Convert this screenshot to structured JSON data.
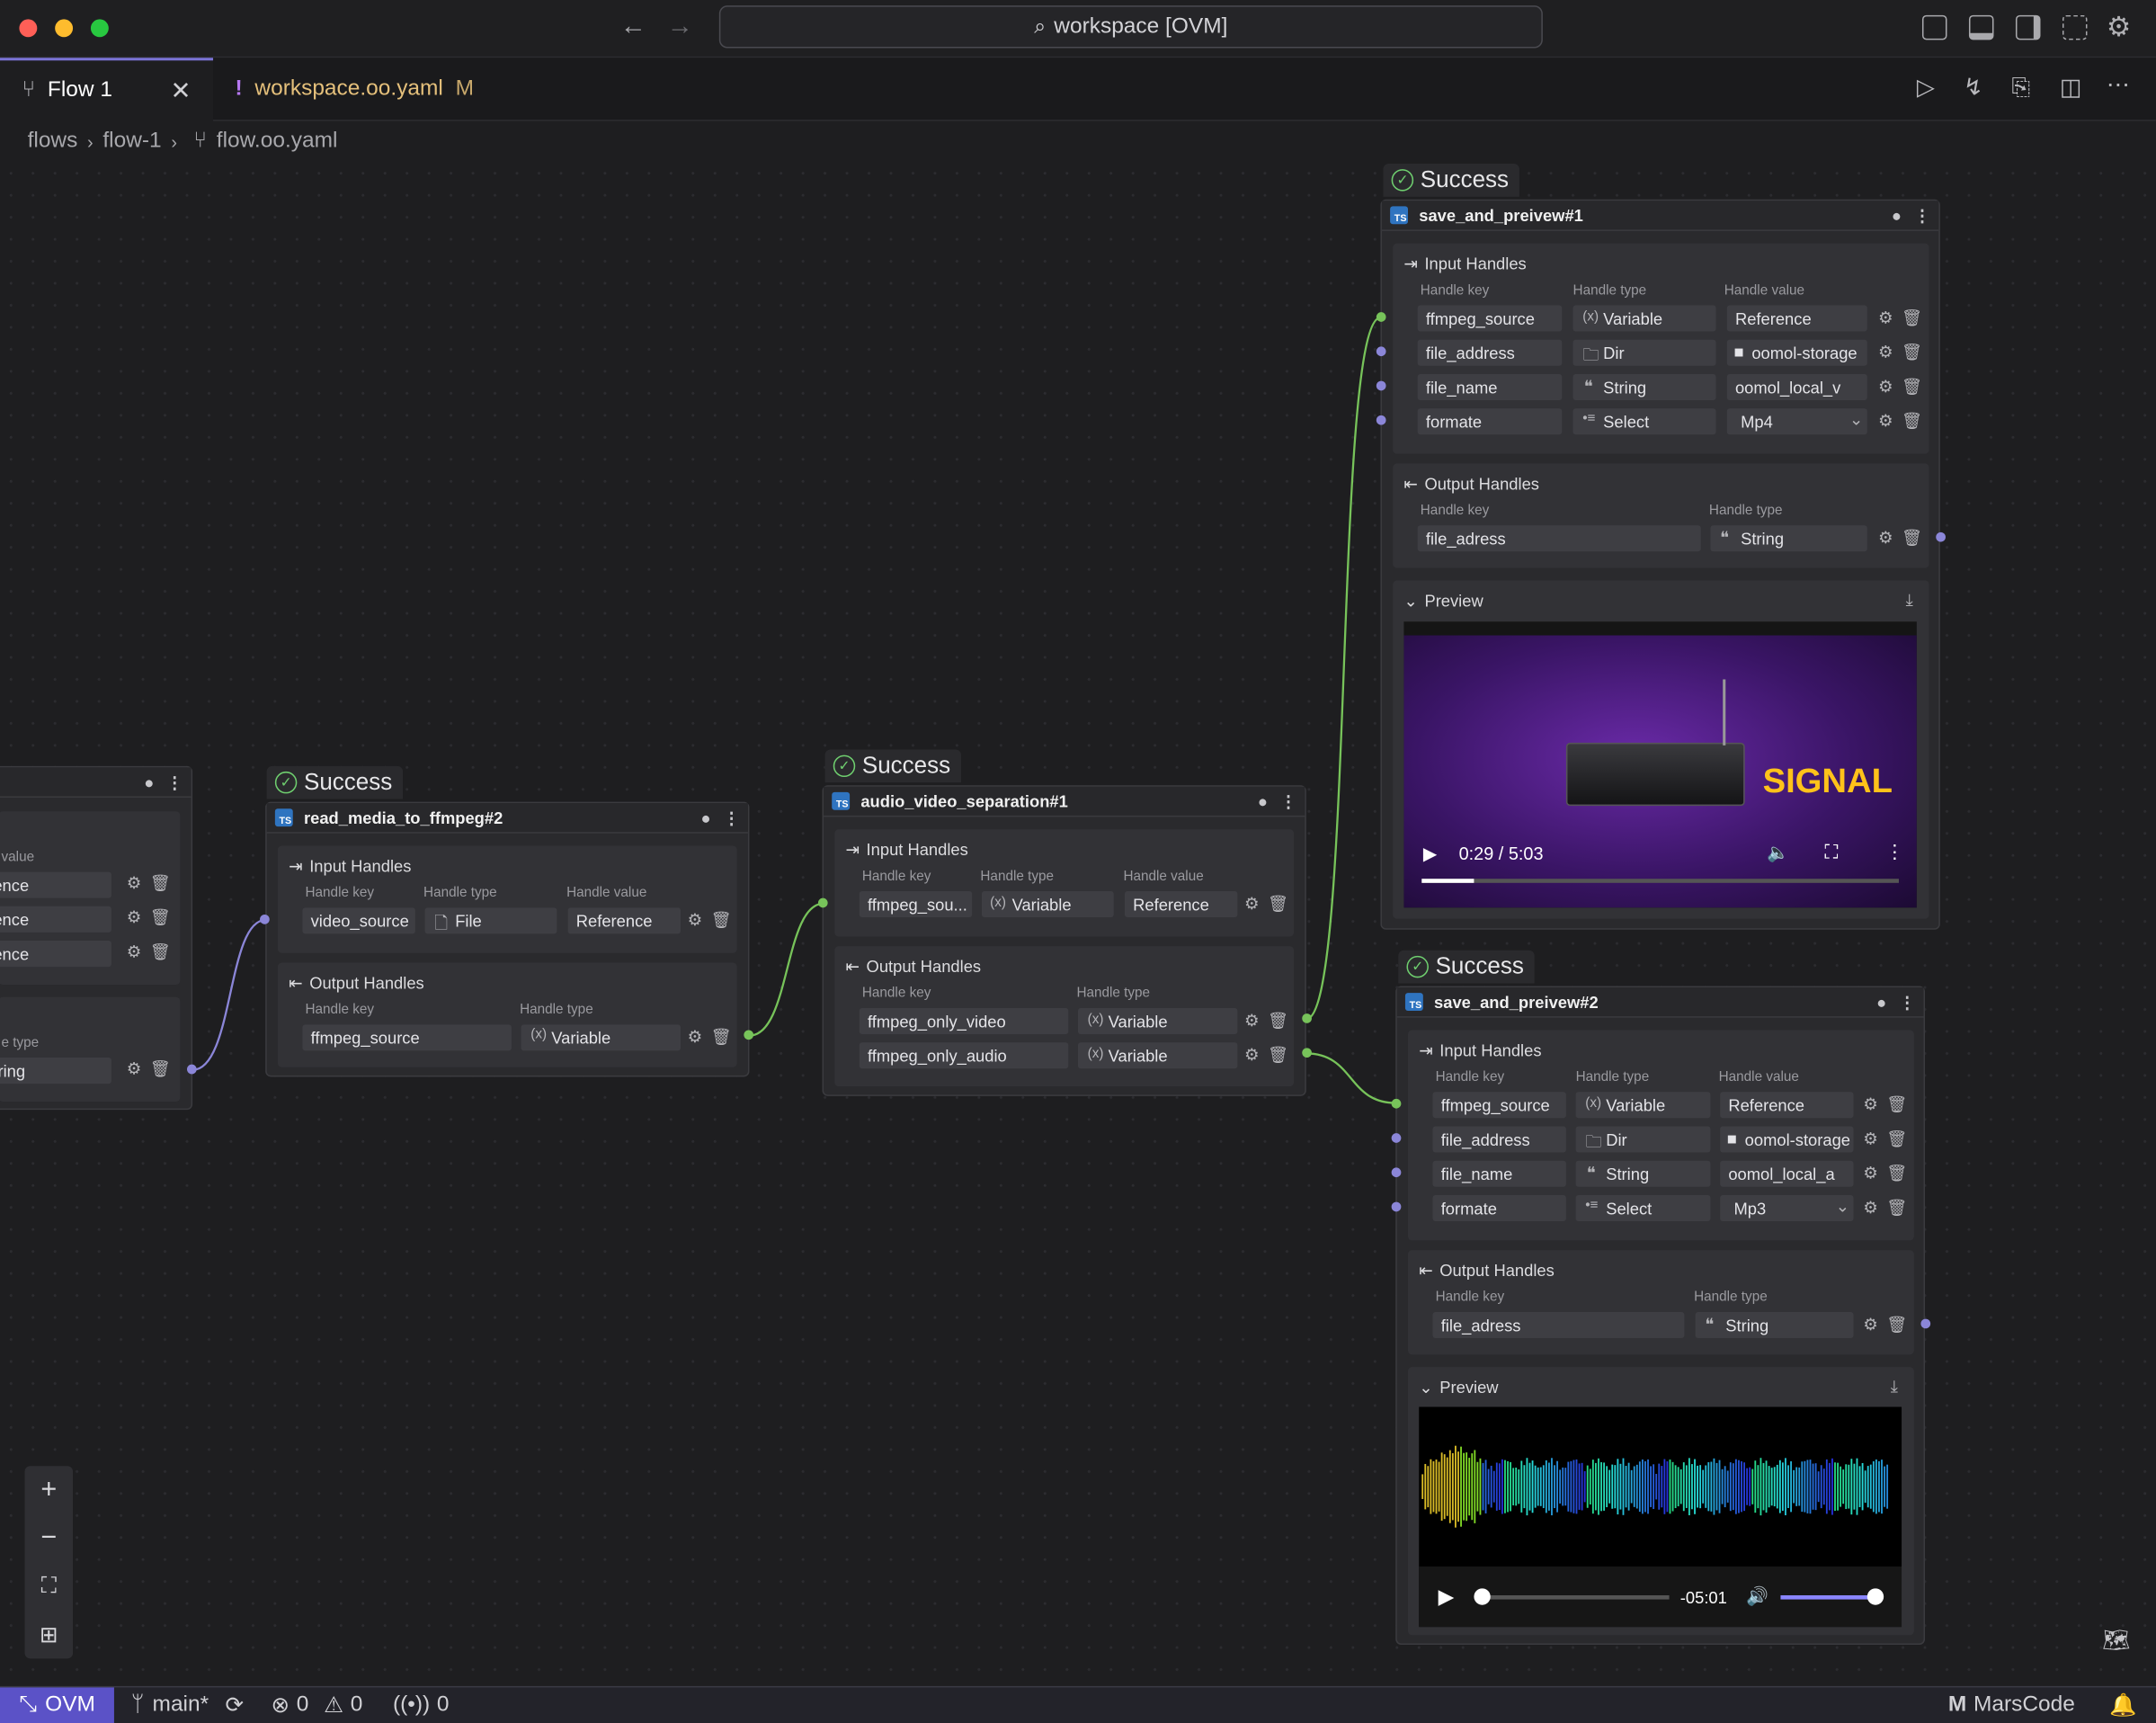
{
  "titlebar": {
    "search": "workspace [OVM]"
  },
  "tabs": [
    {
      "label": "Flow 1"
    },
    {
      "label": "workspace.oo.yaml",
      "badge": "M",
      "prefix": "!"
    }
  ],
  "breadcrumb": [
    "flows",
    "flow-1",
    "flow.oo.yaml"
  ],
  "labels": {
    "input_handles": "Input Handles",
    "output_handles": "Output Handles",
    "handle_key": "Handle key",
    "handle_type": "Handle type",
    "handle_value": "Handle value",
    "preview": "Preview",
    "success": "Success"
  },
  "partial_node": {
    "value_label": "value",
    "values": [
      "ence",
      "ence",
      "ence"
    ],
    "type_label": "e type",
    "type": "tring"
  },
  "read_media": {
    "title": "read_media_to_ffmpeg#2",
    "inputs": [
      {
        "key": "video_source",
        "type": "File",
        "value": "Reference"
      }
    ],
    "outputs": [
      {
        "key": "ffmpeg_source",
        "type": "Variable"
      }
    ]
  },
  "separation": {
    "title": "audio_video_separation#1",
    "inputs": [
      {
        "key": "ffmpeg_sou...",
        "type": "Variable",
        "value": "Reference"
      }
    ],
    "outputs": [
      {
        "key": "ffmpeg_only_video",
        "type": "Variable"
      },
      {
        "key": "ffmpeg_only_audio",
        "type": "Variable"
      }
    ]
  },
  "save1": {
    "title": "save_and_preivew#1",
    "inputs": [
      {
        "key": "ffmpeg_source",
        "type": "Variable",
        "value": "Reference"
      },
      {
        "key": "file_address",
        "type": "Dir",
        "value": "oomol-storage"
      },
      {
        "key": "file_name",
        "type": "String",
        "value": "oomol_local_v"
      },
      {
        "key": "formate",
        "type": "Select",
        "value": "Mp4"
      }
    ],
    "outputs": [
      {
        "key": "file_adress",
        "type": "String"
      }
    ],
    "video": {
      "time": "0:29 / 5:03",
      "overlay": "SIGNAL",
      "progress": 0.11
    }
  },
  "save2": {
    "title": "save_and_preivew#2",
    "inputs": [
      {
        "key": "ffmpeg_source",
        "type": "Variable",
        "value": "Reference"
      },
      {
        "key": "file_address",
        "type": "Dir",
        "value": "oomol-storage"
      },
      {
        "key": "file_name",
        "type": "String",
        "value": "oomol_local_a"
      },
      {
        "key": "formate",
        "type": "Select",
        "value": "Mp3"
      }
    ],
    "outputs": [
      {
        "key": "file_adress",
        "type": "String"
      }
    ],
    "audio": {
      "remaining": "-05:01",
      "progress": 0.01,
      "volume": 1.0
    }
  },
  "statusbar": {
    "ovm": "OVM",
    "branch": "main*",
    "errors": "0",
    "warnings": "0",
    "ports": "0",
    "brand": "MarsCode"
  },
  "colors": {
    "accent": "#5b52c7",
    "success": "#6fcf6f",
    "edge_green": "#77c35a",
    "edge_purple": "#8b86d8"
  }
}
